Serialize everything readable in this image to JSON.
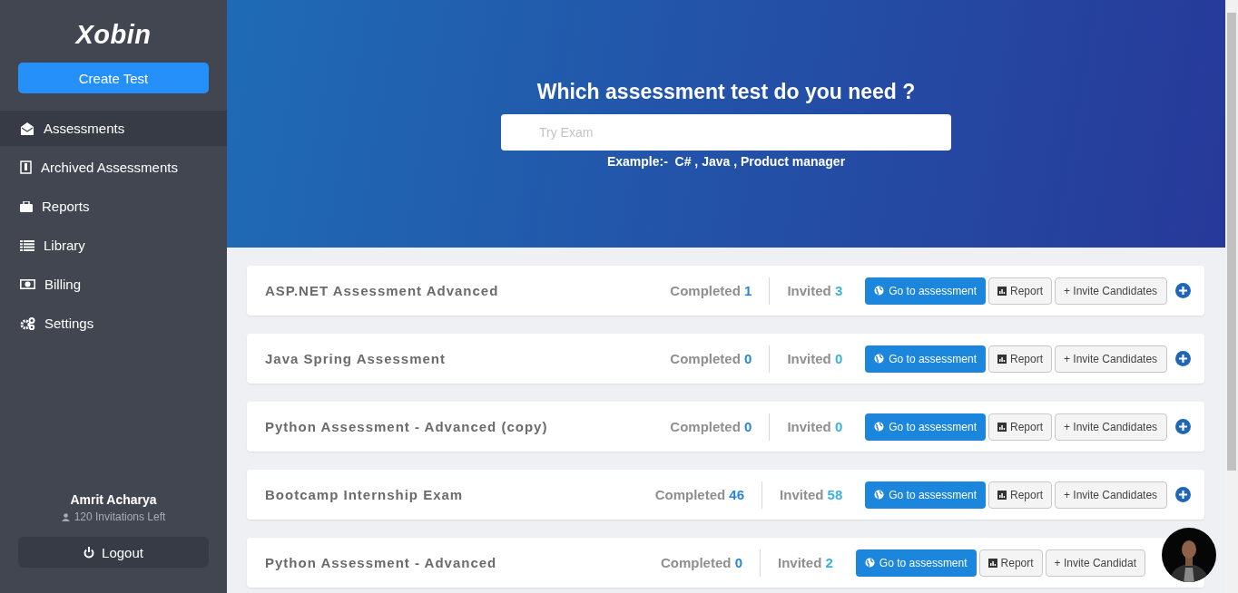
{
  "sidebar": {
    "logo": "Xobin",
    "create_button": "Create Test",
    "items": [
      {
        "label": "Assessments",
        "kind": "envelope",
        "selected": true
      },
      {
        "label": "Archived Assessments",
        "kind": "document",
        "selected": false
      },
      {
        "label": "Reports",
        "kind": "briefcase",
        "selected": false
      },
      {
        "label": "Library",
        "kind": "list",
        "selected": false
      },
      {
        "label": "Billing",
        "kind": "banknote",
        "selected": false
      },
      {
        "label": "Settings",
        "kind": "gears",
        "selected": false
      }
    ],
    "user": {
      "name": "Amrit Acharya",
      "invitations": "120 Invitations Left"
    },
    "logout": "Logout"
  },
  "hero": {
    "title": "Which assessment test do you need ?",
    "search": {
      "placeholder": "Try Exam"
    },
    "example": "Example:-  C# , Java , Product manager"
  },
  "assessments": [
    {
      "title": "ASP.NET Assessment Advanced",
      "completed_label": "Completed",
      "completed": "1",
      "invited_label": "Invited",
      "invited": "3",
      "go": "Go to assessment",
      "report": "Report",
      "invite": "+ Invite Candidates"
    },
    {
      "title": "Java Spring Assessment",
      "completed_label": "Completed",
      "completed": "0",
      "invited_label": "Invited",
      "invited": "0",
      "go": "Go to assessment",
      "report": "Report",
      "invite": "+ Invite Candidates"
    },
    {
      "title": "Python Assessment - Advanced (copy)",
      "completed_label": "Completed",
      "completed": "0",
      "invited_label": "Invited",
      "invited": "0",
      "go": "Go to assessment",
      "report": "Report",
      "invite": "+ Invite Candidates"
    },
    {
      "title": "Bootcamp Internship Exam",
      "completed_label": "Completed",
      "completed": "46",
      "invited_label": "Invited",
      "invited": "58",
      "go": "Go to assessment",
      "report": "Report",
      "invite": "+ Invite Candidates"
    },
    {
      "title": "Python Assessment - Advanced",
      "completed_label": "Completed",
      "completed": "0",
      "invited_label": "Invited",
      "invited": "2",
      "go": "Go to assessment",
      "report": "Report",
      "invite": "+ Invite Candidat"
    }
  ]
}
